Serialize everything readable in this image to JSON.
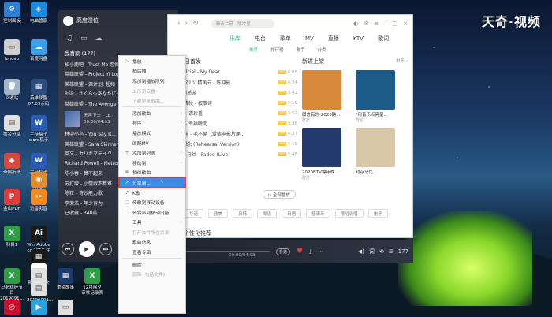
{
  "watermark": "天奇·视频",
  "desktop_icons": [
    {
      "label": "控制面板",
      "color": "#2f7fd0",
      "glyph": "⚙"
    },
    {
      "label": "电脑管家",
      "color": "#1b8be0",
      "glyph": "◈"
    },
    {
      "label": "lenovo",
      "color": "#cfcfcf",
      "glyph": "▭"
    },
    {
      "label": "百度网盘",
      "color": "#3aa0e8",
      "glyph": "☁"
    },
    {
      "label": "回收站",
      "color": "#9fb7c9",
      "glyph": "🗑"
    },
    {
      "label": "英雄联盟 07.09点码",
      "color": "#2b4c7e",
      "glyph": "▦"
    },
    {
      "label": "换名分享",
      "color": "#e0e0e0",
      "glyph": "▤"
    },
    {
      "label": "主持稿子word稿子",
      "color": "#2a5bb5",
      "glyph": "W"
    },
    {
      "label": "奇偶折纸",
      "color": "#d74a3a",
      "glyph": "◆"
    },
    {
      "label": "主持稿子",
      "color": "#2a5bb5",
      "glyph": "W"
    },
    {
      "label": "美食",
      "color": "#e38b2a",
      "glyph": "◉"
    },
    {
      "label": "金山PDF",
      "color": "#e03b3b",
      "glyph": "P"
    },
    {
      "label": "迅雷影音",
      "color": "#f08a1e",
      "glyph": "✂"
    },
    {
      "label": "科目1",
      "color": "#2f9e44",
      "glyph": "X"
    },
    {
      "label": "Win Adobe cc 2018 注册",
      "color": "#1a1a1a",
      "glyph": "Ai"
    },
    {
      "label": "马超辉",
      "color": "#1a1a1a",
      "glyph": "▦"
    },
    {
      "label": "新建文本文档",
      "color": "#fff",
      "glyph": "▤"
    },
    {
      "label": "马超辉经节目 2019091...",
      "color": "#2f9e44",
      "glyph": "X"
    },
    {
      "label": "视频",
      "color": "#e0e0e0",
      "glyph": "▤"
    },
    {
      "label": "20190091...",
      "color": "#e0e0e0",
      "glyph": "▤"
    },
    {
      "label": "重磅故事",
      "color": "#1b3b6e",
      "glyph": "▦"
    },
    {
      "label": "12月除夕 审核记录表",
      "color": "#2f9e44",
      "glyph": "X"
    },
    {
      "label": "",
      "color": "#c8102e",
      "glyph": "◎"
    },
    {
      "label": "",
      "color": "#2aa1e0",
      "glyph": "▶"
    },
    {
      "label": "",
      "color": "#e0e0e0",
      "glyph": "▭"
    }
  ],
  "sidebar": {
    "user_name": "高度溃位",
    "playlist_header": "我喜欢 (177)",
    "items": [
      "松小鹿吧 - Trust Me 恋你",
      "英雄联盟 - Project Yi Log",
      "英雄联盟 - 源计划: 超频",
      "RSP - さくら～あなたに出会えて",
      "英雄联盟 - The Avengers",
      "林中小鸟 - You Say R...",
      "英雄联盟 - Sara Skinner",
      "英文 - カリキマテイク",
      "Richard Powell - Metron",
      "陈小春 - 算不起来",
      "苏打绿 - 小情歌不算难",
      "陈粒 - 奇妙能力歌",
      "李荣浩 - 年少有为",
      "已收藏 - 340首"
    ],
    "now_playing": {
      "title": "无声卫士 - LE...",
      "time": "00:00/04:03"
    },
    "date_line": "2019年12月 ..."
  },
  "menu": {
    "items": [
      {
        "icon": "▷",
        "label": "播放",
        "disabled": false,
        "arrow": false
      },
      {
        "icon": "",
        "label": "稍后播",
        "disabled": false,
        "arrow": false
      },
      {
        "icon": "",
        "label": "添加到播放队列",
        "disabled": false,
        "arrow": false
      },
      {
        "icon": "",
        "label": "上传到云盘",
        "disabled": true,
        "arrow": false
      },
      {
        "icon": "",
        "label": "下载更多歌曲...",
        "disabled": true,
        "arrow": false
      },
      {
        "sep": true
      },
      {
        "icon": "",
        "label": "添加歌曲",
        "disabled": false,
        "arrow": true
      },
      {
        "icon": "",
        "label": "排序",
        "disabled": false,
        "arrow": true
      },
      {
        "icon": "",
        "label": "播放模式",
        "disabled": false,
        "arrow": true
      },
      {
        "icon": "",
        "label": "匹配MV",
        "disabled": false,
        "arrow": false
      },
      {
        "icon": "+",
        "label": "添加到列表",
        "disabled": false,
        "arrow": true
      },
      {
        "icon": "",
        "label": "移动到",
        "disabled": false,
        "arrow": true
      },
      {
        "icon": "⊗",
        "label": "相似歌曲",
        "disabled": false,
        "arrow": false
      },
      {
        "icon": "↗",
        "label": "分享到...",
        "disabled": false,
        "arrow": false,
        "selected": true
      },
      {
        "icon": "♪",
        "label": "K歌",
        "disabled": false,
        "arrow": false
      },
      {
        "icon": "⬚",
        "label": "传歌到移动设备",
        "disabled": false,
        "arrow": false
      },
      {
        "icon": "⬚",
        "label": "传铃声到移动设备",
        "disabled": false,
        "arrow": false
      },
      {
        "icon": "",
        "label": "工具",
        "disabled": false,
        "arrow": true
      },
      {
        "icon": "",
        "label": "打开文件所在目录",
        "disabled": true,
        "arrow": false
      },
      {
        "icon": "",
        "label": "歌曲信息",
        "disabled": false,
        "arrow": false
      },
      {
        "icon": "",
        "label": "查看专辑",
        "disabled": false,
        "arrow": false
      },
      {
        "sep": true
      },
      {
        "icon": "",
        "label": "删除",
        "disabled": false,
        "arrow": false
      },
      {
        "icon": "",
        "label": "删除 (包括文件)",
        "disabled": true,
        "arrow": false
      }
    ]
  },
  "window": {
    "search_placeholder": "雅诗兰黛 - 陈冲曼",
    "tabs": [
      "乐库",
      "电台",
      "歌单",
      "MV",
      "直播",
      "KTV",
      "歌词"
    ],
    "subtabs": [
      "推荐",
      "排行榜",
      "歌手",
      "分类"
    ],
    "section_title": "每日首发",
    "songs": [
      {
        "title": "Official - My Dear",
        "dur": "4:05"
      },
      {
        "title": "中文101精美云 - 陈冲曼",
        "dur": "4:24"
      },
      {
        "title": "- 逍遥游",
        "dur": "3:42"
      },
      {
        "title": "薄清秋 - 叔事诗",
        "dur": "4:19"
      },
      {
        "title": "中 - 请珍重",
        "dur": "3:52"
      },
      {
        "title": "东 - 幸福時間",
        "dur": "3:36"
      },
      {
        "title": "夜神 - 毛不易【爱情电影片尾...",
        "dur": "4:27"
      },
      {
        "title": "- 想念 (Rehearsal Version)",
        "dur": "4:19"
      },
      {
        "title": "品, 马丝 - Faded (Live)",
        "dur": "3:48"
      }
    ],
    "play_all": "▷ 全部播放",
    "new_release_title": "新碟上架",
    "more": "更多 ›",
    "albums": [
      {
        "name": "暖言有你·2020跨...",
        "singer": "群星",
        "cover": "#d8893a"
      },
      {
        "name": "\"用音乐点亮星...",
        "singer": "群星",
        "cover": "#1d5b8a"
      },
      {
        "name": "2020BTV跨年晚...",
        "singer": "群星",
        "cover": "#243a6e"
      },
      {
        "name": "封存记忆",
        "singer": "",
        "cover": "#d9c8a8"
      }
    ],
    "genres": [
      "华语",
      "欧美",
      "日韩",
      "粤语",
      "日语",
      "摇滚乐",
      "嘻哈说唱",
      "电子"
    ],
    "rec_title": "个性化推荐"
  },
  "playbar": {
    "time": "00:00/04:03",
    "quality": "极速",
    "count": "177"
  }
}
